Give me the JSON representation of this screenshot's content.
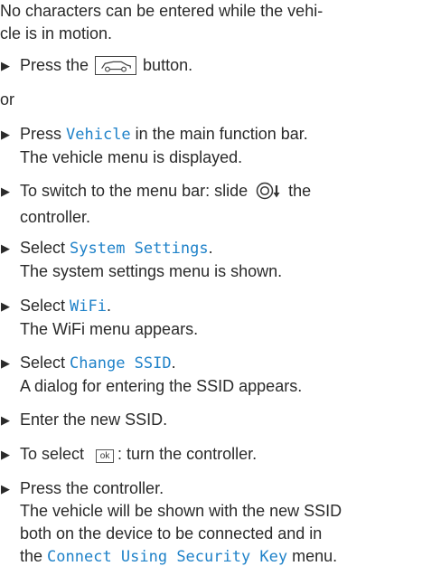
{
  "intro_line1": "No characters can be entered while the vehi-",
  "intro_line2": "cle is in motion.",
  "step1": {
    "prefix": "Press the ",
    "suffix": " button."
  },
  "or_label": "or",
  "step2": {
    "prefix": "Press ",
    "code": "Vehicle",
    "suffix": " in the main function bar.",
    "result": "The vehicle menu is displayed."
  },
  "step3": {
    "prefix": "To switch to the menu bar: slide ",
    "suffix": " the",
    "line2": "controller."
  },
  "step4": {
    "prefix": "Select ",
    "code": "System Settings",
    "suffix": ".",
    "result": "The system settings menu is shown."
  },
  "step5": {
    "prefix": "Select ",
    "code": "WiFi",
    "suffix": ".",
    "result": "The WiFi menu appears."
  },
  "step6": {
    "prefix": "Select ",
    "code": "Change SSID",
    "suffix": ".",
    "result": "A dialog for entering the SSID appears."
  },
  "step7": {
    "text": "Enter the new SSID."
  },
  "step8": {
    "prefix": "To select ",
    "ok_label": "ok",
    "suffix": ": turn the controller."
  },
  "step9": {
    "text": "Press the controller.",
    "result_line1": "The vehicle will be shown with the new SSID",
    "result_line2": "both on the device to be connected and in",
    "result_line3_prefix": "the ",
    "result_code": "Connect Using Security Key",
    "result_line3_suffix": " menu."
  },
  "icons": {
    "bullet": "triangle-right",
    "car_button": "vehicle-button-icon",
    "controller_slide": "controller-slide-down-icon"
  },
  "colors": {
    "menu_text": "#1f82c9",
    "body_text": "#2a2a2a"
  }
}
